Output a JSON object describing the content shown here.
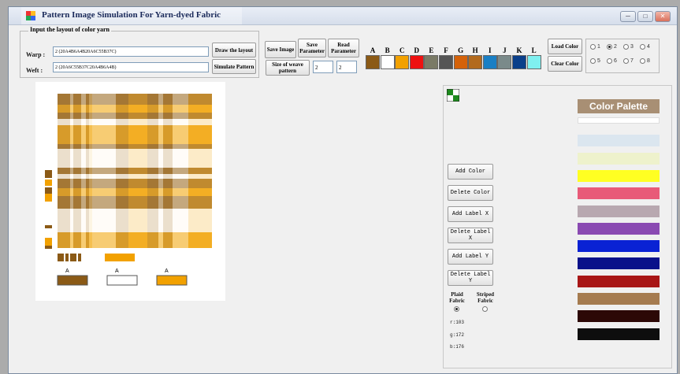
{
  "window": {
    "title": "Pattern Image Simulation For Yarn-dyed Fabric",
    "controls": [
      "─",
      "□",
      "✕"
    ]
  },
  "layout_group": {
    "label": "Input the layout of color yarn",
    "warp_label": "Warp :",
    "warp_value": "2 (20A4B6A4B20A6C55B37C)",
    "weft_label": "Weft :",
    "weft_value": "2 (20A6C55B37C20A4B6A4B)"
  },
  "buttons": {
    "draw_layout": "Draw the layout",
    "simulate_pattern": "Simulate Pattern",
    "save_image": "Save Image",
    "save_parameter": "Save Parameter",
    "read_parameter": "Read Parameter",
    "weave_size": "Size of weave pattern",
    "load_color": "Load Color",
    "clear_color": "Clear Color"
  },
  "weave_size": {
    "w": "2",
    "h": "2"
  },
  "colors": [
    {
      "letter": "A",
      "hex": "#8b5a16"
    },
    {
      "letter": "B",
      "hex": "#ffffff"
    },
    {
      "letter": "C",
      "hex": "#f2a100"
    },
    {
      "letter": "D",
      "hex": "#ee1111"
    },
    {
      "letter": "E",
      "hex": "#7a7a66"
    },
    {
      "letter": "F",
      "hex": "#555555"
    },
    {
      "letter": "G",
      "hex": "#d4620a"
    },
    {
      "letter": "H",
      "hex": "#b26a1e"
    },
    {
      "letter": "I",
      "hex": "#1a7fc4"
    },
    {
      "letter": "J",
      "hex": "#7a8a8a"
    },
    {
      "letter": "K",
      "hex": "#0a3f8a"
    },
    {
      "letter": "L",
      "hex": "#7ff0f0"
    }
  ],
  "radios": [
    {
      "label": "1",
      "checked": false
    },
    {
      "label": "2",
      "checked": true
    },
    {
      "label": "3",
      "checked": false
    },
    {
      "label": "4",
      "checked": false
    },
    {
      "label": "5",
      "checked": false
    },
    {
      "label": "6",
      "checked": false
    },
    {
      "label": "7",
      "checked": false
    },
    {
      "label": "8",
      "checked": false
    }
  ],
  "legend": [
    {
      "label": "A",
      "hex": "#8b5a16"
    },
    {
      "label": "A",
      "hex": "#ffffff"
    },
    {
      "label": "A",
      "hex": "#f2a100"
    }
  ],
  "actions": {
    "add_color": "Add Color",
    "delete_color": "Delete Color",
    "add_label_x": "Add Label X",
    "delete_label_x": "Delete Label X",
    "add_label_y": "Add Label Y",
    "delete_label_y": "Delete Label Y"
  },
  "fabric_type": {
    "plaid": "Plaid Fabric",
    "striped": "Striped Fabric",
    "selected": "plaid"
  },
  "rgb": {
    "r": "r:103",
    "g": "g:172",
    "b": "b:176"
  },
  "palette": {
    "title": "Color Palette",
    "colors": [
      "#ffffff",
      "#dbe6ef",
      "#eef2cc",
      "#ffff22",
      "#e85a78",
      "#b8a8b0",
      "#8a4ab2",
      "#0a22d4",
      "#0a118a",
      "#a81616",
      "#a57b4f",
      "#2c0806",
      "#0e0e0e"
    ]
  }
}
